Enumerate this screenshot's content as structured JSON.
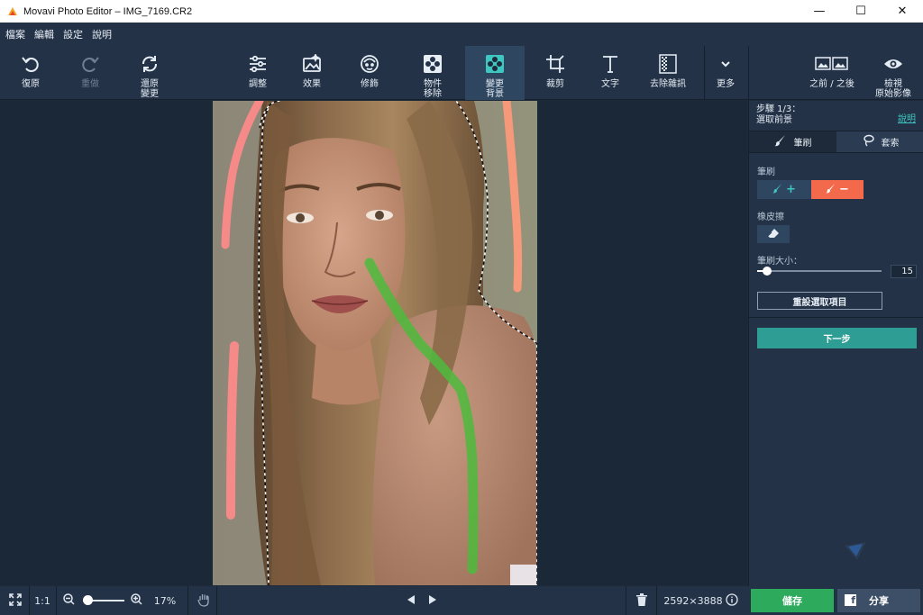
{
  "window": {
    "title": "Movavi Photo Editor – IMG_7169.CR2",
    "minimize": "—",
    "maximize": "☐",
    "close": "✕"
  },
  "menu": [
    "檔案",
    "編輯",
    "設定",
    "說明"
  ],
  "toolbar": {
    "undo": "復原",
    "redo": "重做",
    "restore": "還原\n變更",
    "adjust": "調整",
    "effects": "效果",
    "retouch": "修飾",
    "object_removal": "物件\n移除",
    "change_bg": "變更\n背景",
    "crop": "裁剪",
    "text": "文字",
    "denoise": "去除雜訊",
    "more": "更多",
    "before_after": "之前 / 之後",
    "view_original": "檢視\n原始影像"
  },
  "panel": {
    "step": "步驟 1/3：",
    "step_desc": "選取前景",
    "help": "說明",
    "tab_brush": "筆刷",
    "tab_lasso": "套索",
    "brush_label": "筆刷",
    "brush_add": "+",
    "brush_remove": "−",
    "eraser_label": "橡皮擦",
    "size_label": "筆刷大小：",
    "size_value": "15",
    "size_fraction": 0.08,
    "reset": "重設選取項目",
    "next": "下一步"
  },
  "bottom": {
    "fit": "⤢",
    "one_to_one": "1:1",
    "zoom_value": "17%",
    "zoom_fraction": 0.1,
    "dimensions": "2592×3888",
    "save": "儲存",
    "share": "分享"
  },
  "colors": {
    "accent_teal": "#2e9e94",
    "brush_add": "#2f4661",
    "brush_remove": "#f26a4b",
    "save_green": "#2eaa5d",
    "stroke_green": "#4cbb3c",
    "stroke_pink": "#ff8a8a"
  }
}
